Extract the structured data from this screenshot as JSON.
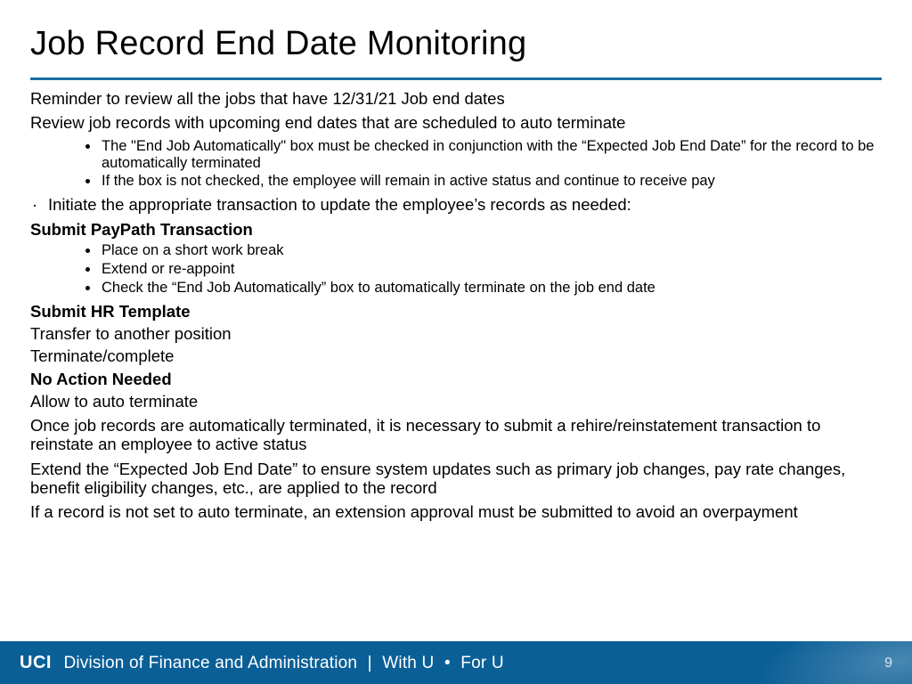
{
  "title": "Job Record End Date Monitoring",
  "body": {
    "p1": "Reminder to review all the jobs that have 12/31/21 Job end dates",
    "p2": "Review job records with upcoming end dates that are scheduled to auto terminate",
    "sub1": {
      "a": "The \"End Job Automatically\" box must be checked in conjunction with the “Expected Job End Date” for the record to be automatically terminated",
      "b": "If the box is not checked, the employee will remain in active status and continue to receive pay"
    },
    "p3": "Initiate the appropriate transaction to update the employee’s records as needed:",
    "h1": "Submit PayPath Transaction",
    "sub2": {
      "a": "Place on a short work break",
      "b": "Extend or re-appoint",
      "c": "Check the “End Job Automatically” box to automatically terminate on the job end date"
    },
    "h2": "Submit HR Template",
    "p4": "Transfer to another position",
    "p5": "Terminate/complete",
    "h3": "No Action Needed",
    "p6": "Allow to auto terminate",
    "p7": "Once job records are automatically terminated, it is necessary to submit a rehire/reinstatement transaction to reinstate an employee to active status",
    "p8": "Extend the “Expected Job End Date” to ensure system updates such as primary job changes, pay rate changes, benefit eligibility changes, etc., are applied to the record",
    "p9": "If a record is not set to auto terminate, an extension approval must be submitted to avoid an overpayment"
  },
  "footer": {
    "uci": "UCI",
    "division": "Division of Finance and Administration",
    "withu": "With U",
    "foru": "For U",
    "page": "9"
  }
}
